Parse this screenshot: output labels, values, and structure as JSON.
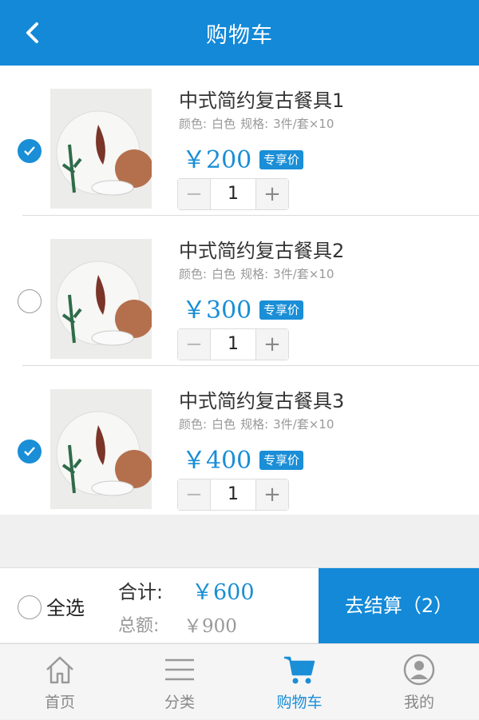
{
  "header": {
    "title": "购物车"
  },
  "cart": {
    "items": [
      {
        "name": "中式简约复古餐具1",
        "color_label": "颜色:",
        "color": "白色",
        "spec_label": "规格:",
        "spec": "3件/套×10",
        "price": "￥200",
        "tag": "专享价",
        "qty": "1",
        "checked": true
      },
      {
        "name": "中式简约复古餐具2",
        "color_label": "颜色:",
        "color": "白色",
        "spec_label": "规格:",
        "spec": "3件/套×10",
        "price": "￥300",
        "tag": "专享价",
        "qty": "1",
        "checked": false
      },
      {
        "name": "中式简约复古餐具3",
        "color_label": "颜色:",
        "color": "白色",
        "spec_label": "规格:",
        "spec": "3件/套×10",
        "price": "￥400",
        "tag": "专享价",
        "qty": "1",
        "checked": true
      }
    ],
    "minus": "−",
    "plus": "+"
  },
  "summary": {
    "select_all": "全选",
    "subtotal_label": "合计:",
    "subtotal": "￥600",
    "total_label": "总额:",
    "total": "￥900",
    "checkout": "去结算（2）"
  },
  "tabbar": {
    "tabs": [
      {
        "label": "首页",
        "icon": "home-icon"
      },
      {
        "label": "分类",
        "icon": "menu-icon"
      },
      {
        "label": "购物车",
        "icon": "cart-icon"
      },
      {
        "label": "我的",
        "icon": "user-icon"
      }
    ],
    "active_index": 2
  },
  "colors": {
    "primary": "#1389d8",
    "accent": "#1a8ed6"
  }
}
